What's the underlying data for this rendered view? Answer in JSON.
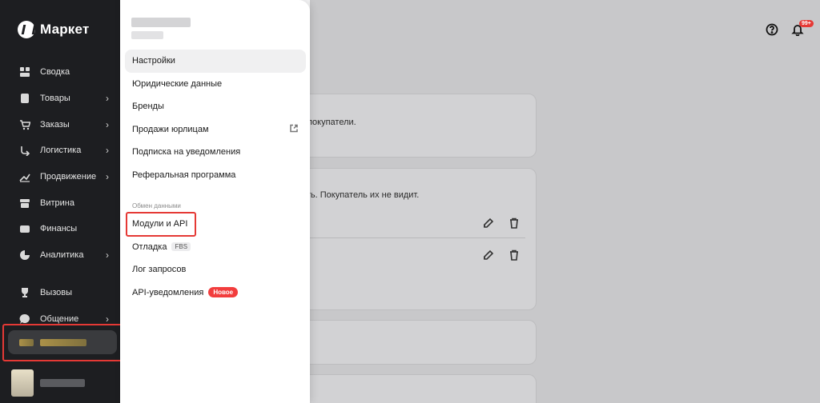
{
  "sidebar": {
    "logo": "Маркет",
    "items": [
      {
        "label": "Сводка",
        "icon": "dashboard-icon",
        "chevron": false
      },
      {
        "label": "Товары",
        "icon": "box-icon",
        "chevron": true
      },
      {
        "label": "Заказы",
        "icon": "cart-icon",
        "chevron": true
      },
      {
        "label": "Логистика",
        "icon": "route-icon",
        "chevron": true
      },
      {
        "label": "Продвижение",
        "icon": "trend-up-icon",
        "chevron": true
      },
      {
        "label": "Витрина",
        "icon": "storefront-icon",
        "chevron": false
      },
      {
        "label": "Финансы",
        "icon": "wallet-icon",
        "chevron": false
      },
      {
        "label": "Аналитика",
        "icon": "pie-chart-icon",
        "chevron": true
      }
    ],
    "items2": [
      {
        "label": "Вызовы",
        "icon": "trophy-icon",
        "chevron": false
      },
      {
        "label": "Общение",
        "icon": "chat-icon",
        "chevron": true
      }
    ]
  },
  "panel": {
    "items": [
      {
        "label": "Настройки",
        "active": true
      },
      {
        "label": "Юридические данные"
      },
      {
        "label": "Бренды"
      },
      {
        "label": "Продажи юрлицам",
        "external": true
      },
      {
        "label": "Подписка на уведомления"
      },
      {
        "label": "Реферальная программа"
      }
    ],
    "section_label": "Обмен данными",
    "exchange": [
      {
        "label": "Модули и API"
      },
      {
        "label": "Отладка",
        "tag": "FBS"
      },
      {
        "label": "Лог запросов"
      },
      {
        "label": "API-уведомления",
        "badge": "Новое"
      }
    ]
  },
  "main": {
    "card1_text": "г покупатели.",
    "card2_text": "ать. Покупатель их не видит.",
    "notifications_count": "99+"
  }
}
